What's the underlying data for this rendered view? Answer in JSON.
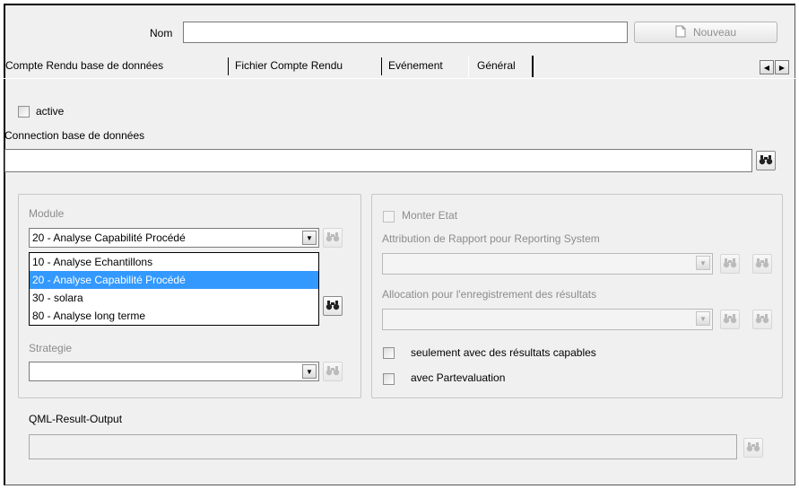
{
  "header": {
    "name_label": "Nom",
    "name_value": "",
    "new_button_label": "Nouveau"
  },
  "tabs": [
    {
      "label": "Compte Rendu base de données"
    },
    {
      "label": "Fichier Compte Rendu"
    },
    {
      "label": "Evénement"
    },
    {
      "label": "Général"
    }
  ],
  "general": {
    "active_label": "active",
    "active_checked": false,
    "connection_label": "Connection base de données",
    "connection_value": ""
  },
  "left_group": {
    "module_label": "Module",
    "module_selected": "20 - Analyse Capabilité Procédé",
    "module_options": [
      {
        "label": "10 - Analyse Echantillons"
      },
      {
        "label": "20 - Analyse Capabilité Procédé"
      },
      {
        "label": "30 - solara"
      },
      {
        "label": "80 - Analyse long terme"
      }
    ],
    "strategie_label": "Strategie",
    "strategie_value": ""
  },
  "right_group": {
    "monter_etat_label": "Monter Etat",
    "attribution_label": "Attribution de Rapport pour Reporting System",
    "allocation_label": "Allocation pour l'enregistrement des résultats",
    "capables_label": "seulement avec des résultats capables",
    "partevaluation_label": "avec Partevaluation"
  },
  "qml": {
    "label": "QML-Result-Output",
    "value": ""
  },
  "colors": {
    "selection": "#3399ff",
    "background": "#f0f0f0"
  }
}
